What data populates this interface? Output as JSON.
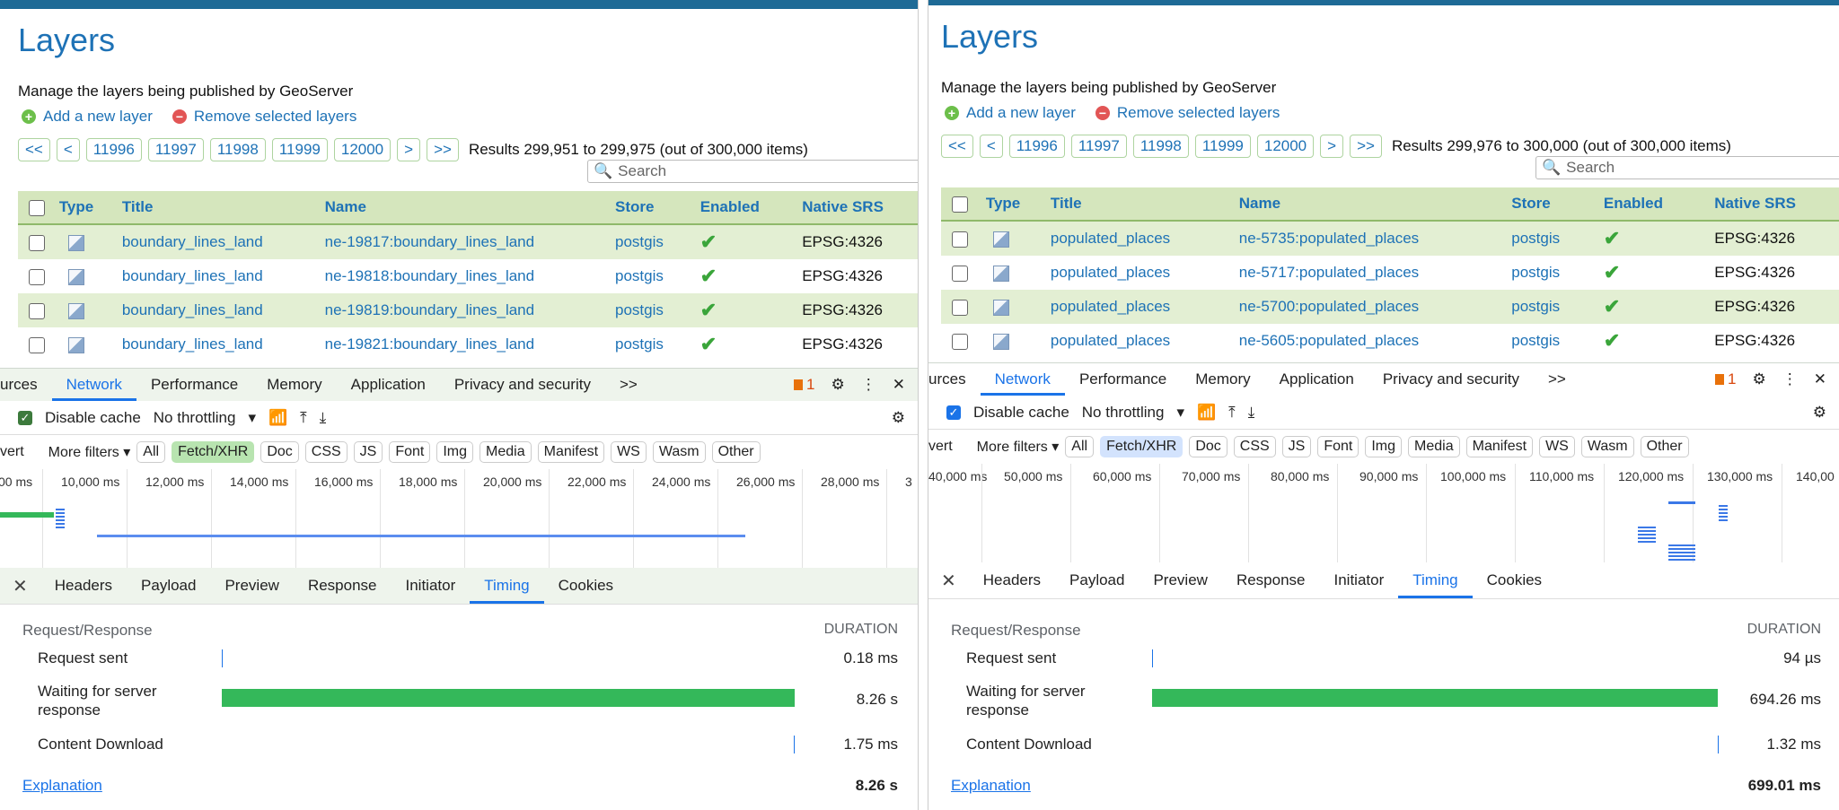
{
  "left": {
    "title": "Layers",
    "subtitle": "Manage the layers being published by GeoServer",
    "add_layer": "Add a new layer",
    "remove_layers": "Remove selected layers",
    "pager": [
      "<<",
      "<",
      "11996",
      "11997",
      "11998",
      "11999",
      "12000",
      ">",
      ">>"
    ],
    "results": "Results 299,951 to 299,975 (out of 300,000 items)",
    "search_placeholder": "Search",
    "columns": [
      "Type",
      "Title",
      "Name",
      "Store",
      "Enabled",
      "Native SRS"
    ],
    "rows": [
      {
        "title": "boundary_lines_land",
        "name": "ne-19817:boundary_lines_land",
        "store": "postgis",
        "srs": "EPSG:4326"
      },
      {
        "title": "boundary_lines_land",
        "name": "ne-19818:boundary_lines_land",
        "store": "postgis",
        "srs": "EPSG:4326"
      },
      {
        "title": "boundary_lines_land",
        "name": "ne-19819:boundary_lines_land",
        "store": "postgis",
        "srs": "EPSG:4326"
      },
      {
        "title": "boundary_lines_land",
        "name": "ne-19821:boundary_lines_land",
        "store": "postgis",
        "srs": "EPSG:4326"
      }
    ],
    "devtools_tabs": [
      "urces",
      "Network",
      "Performance",
      "Memory",
      "Application",
      "Privacy and security"
    ],
    "more_tabs": ">>",
    "issues_count": "1",
    "disable_cache": "Disable cache",
    "throttling": "No throttling",
    "invert": "vert",
    "more_filters": "More filters",
    "filters": [
      "All",
      "Fetch/XHR",
      "Doc",
      "CSS",
      "JS",
      "Font",
      "Img",
      "Media",
      "Manifest",
      "WS",
      "Wasm",
      "Other"
    ],
    "timeline_ticks": [
      "00 ms",
      "10,000 ms",
      "12,000 ms",
      "14,000 ms",
      "16,000 ms",
      "18,000 ms",
      "20,000 ms",
      "22,000 ms",
      "24,000 ms",
      "26,000 ms",
      "28,000 ms",
      "3"
    ],
    "detail_tabs": [
      "Headers",
      "Payload",
      "Preview",
      "Response",
      "Initiator",
      "Timing",
      "Cookies"
    ],
    "timing": {
      "section": "Request/Response",
      "duration_header": "DURATION",
      "request_sent": "Request sent",
      "request_sent_value": "0.18 ms",
      "waiting_line1": "Waiting for server",
      "waiting_line2": "response",
      "waiting_value": "8.26 s",
      "download": "Content Download",
      "download_value": "1.75 ms",
      "explanation": "Explanation",
      "total": "8.26 s"
    }
  },
  "right": {
    "title": "Layers",
    "subtitle": "Manage the layers being published by GeoServer",
    "add_layer": "Add a new layer",
    "remove_layers": "Remove selected layers",
    "pager": [
      "<<",
      "<",
      "11996",
      "11997",
      "11998",
      "11999",
      "12000",
      ">",
      ">>"
    ],
    "results": "Results 299,976 to 300,000 (out of 300,000 items)",
    "search_placeholder": "Search",
    "columns": [
      "Type",
      "Title",
      "Name",
      "Store",
      "Enabled",
      "Native SRS"
    ],
    "rows": [
      {
        "title": "populated_places",
        "name": "ne-5735:populated_places",
        "store": "postgis",
        "srs": "EPSG:4326"
      },
      {
        "title": "populated_places",
        "name": "ne-5717:populated_places",
        "store": "postgis",
        "srs": "EPSG:4326"
      },
      {
        "title": "populated_places",
        "name": "ne-5700:populated_places",
        "store": "postgis",
        "srs": "EPSG:4326"
      },
      {
        "title": "populated_places",
        "name": "ne-5605:populated_places",
        "store": "postgis",
        "srs": "EPSG:4326"
      }
    ],
    "devtools_tabs": [
      "urces",
      "Network",
      "Performance",
      "Memory",
      "Application",
      "Privacy and security"
    ],
    "more_tabs": ">>",
    "issues_count": "1",
    "disable_cache": "Disable cache",
    "throttling": "No throttling",
    "invert": "vert",
    "more_filters": "More filters",
    "filters": [
      "All",
      "Fetch/XHR",
      "Doc",
      "CSS",
      "JS",
      "Font",
      "Img",
      "Media",
      "Manifest",
      "WS",
      "Wasm",
      "Other"
    ],
    "timeline_ticks": [
      "40,000 ms",
      "50,000 ms",
      "60,000 ms",
      "70,000 ms",
      "80,000 ms",
      "90,000 ms",
      "100,000 ms",
      "110,000 ms",
      "120,000 ms",
      "130,000 ms",
      "140,00"
    ],
    "detail_tabs": [
      "Headers",
      "Payload",
      "Preview",
      "Response",
      "Initiator",
      "Timing",
      "Cookies"
    ],
    "timing": {
      "section": "Request/Response",
      "duration_header": "DURATION",
      "request_sent": "Request sent",
      "request_sent_value": "94 µs",
      "waiting_line1": "Waiting for server",
      "waiting_line2": "response",
      "waiting_value": "694.26 ms",
      "download": "Content Download",
      "download_value": "1.32 ms",
      "explanation": "Explanation",
      "total": "699.01 ms"
    }
  },
  "colors": {
    "accent": "#1a73e8",
    "geoserver_link": "#1e72b6",
    "bar_green": "#34b85a",
    "row_alt": "#e3efd3"
  }
}
